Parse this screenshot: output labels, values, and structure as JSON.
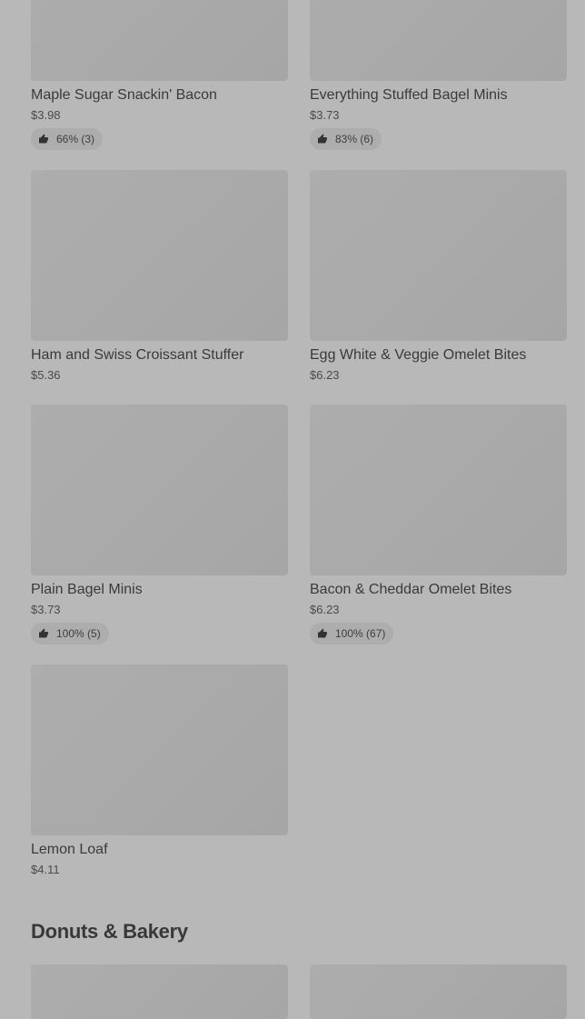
{
  "products": [
    {
      "name": "Maple Sugar Snackin' Bacon",
      "price": "$3.98",
      "rating": "66% (3)"
    },
    {
      "name": "Everything Stuffed Bagel Minis",
      "price": "$3.73",
      "rating": "83% (6)"
    },
    {
      "name": "Ham and Swiss Croissant Stuffer",
      "price": "$5.36"
    },
    {
      "name": "Egg White & Veggie Omelet Bites",
      "price": "$6.23"
    },
    {
      "name": "Plain Bagel Minis",
      "price": "$3.73",
      "rating": "100% (5)"
    },
    {
      "name": "Bacon & Cheddar Omelet Bites",
      "price": "$6.23",
      "rating": "100% (67)"
    },
    {
      "name": "Lemon Loaf",
      "price": "$4.11"
    }
  ],
  "section": {
    "title": "Donuts & Bakery"
  },
  "icons": {
    "rating": "thumbs-up-icon"
  }
}
